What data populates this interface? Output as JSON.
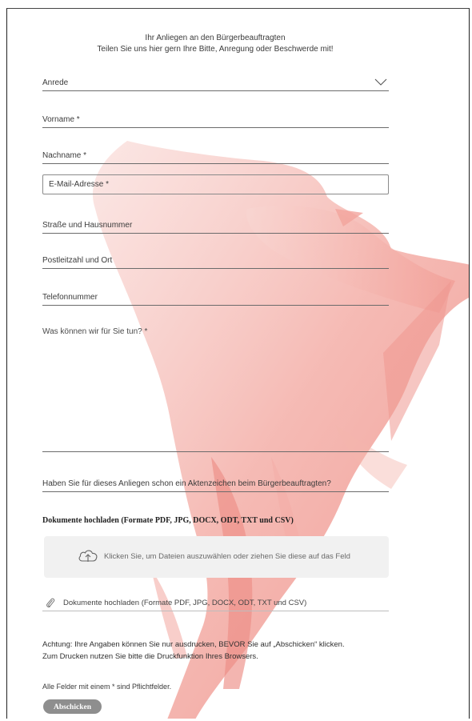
{
  "header": {
    "line1": "Ihr Anliegen an den Bürgerbeauftragten",
    "line2": "Teilen Sie uns hier gern Ihre Bitte, Anregung oder Beschwerde mit!"
  },
  "form": {
    "anrede": "Anrede",
    "vorname": "Vorname *",
    "nachname": "Nachname *",
    "email": "E-Mail-Adresse *",
    "strasse": "Straße und Hausnummer",
    "plz_ort": "Postleitzahl und Ort",
    "telefon": "Telefonnummer",
    "anliegen": "Was können wir für Sie tun? *",
    "aktenzeichen": "Haben Sie für dieses Anliegen schon ein Aktenzeichen beim Bürgerbeauftragten?"
  },
  "upload": {
    "title": "Dokumente hochladen (Formate PDF, JPG, DOCX, ODT, TXT und CSV)",
    "dropzone_text": "Klicken Sie, um Dateien auszuwählen oder ziehen Sie diese auf das Feld",
    "attach_text": "Dokumente hochladen (Formate PDF, JPG, DOCX, ODT, TXT und CSV)"
  },
  "notes": {
    "print_line1": "Achtung: Ihre Angaben können Sie nur ausdrucken, BEVOR Sie auf „Abschicken“ klicken.",
    "print_line2": "Zum Drucken nutzen Sie bitte die Druckfunktion Ihres Browsers.",
    "required": "Alle Felder mit einem * sind Pflichtfelder."
  },
  "submit_label": "Abschicken",
  "colors": {
    "brush": "#f3b3ac",
    "brush_dark": "#ec8e86",
    "button": "#8e8e8e"
  }
}
